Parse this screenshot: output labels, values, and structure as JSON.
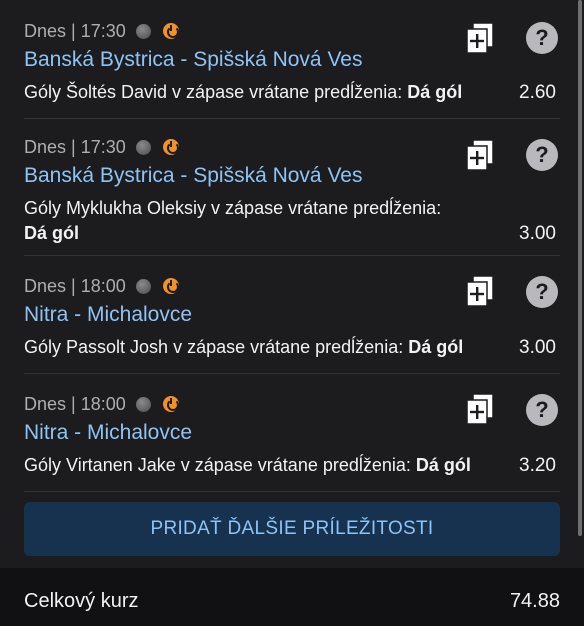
{
  "bets": [
    {
      "time": "Dnes | 17:30",
      "match": "Banská Bystrica - Spišská Nová Ves",
      "market": "Góly Šoltés David v zápase vrátane predĺženia:",
      "selection": "Dá gól",
      "odds": "2.60"
    },
    {
      "time": "Dnes | 17:30",
      "match": "Banská Bystrica - Spišská Nová Ves",
      "market": "Góly Myklukha Oleksiy v zápase vrátane predĺženia:",
      "selection": "Dá gól",
      "odds": "3.00"
    },
    {
      "time": "Dnes | 18:00",
      "match": "Nitra - Michalovce",
      "market": "Góly Passolt Josh v zápase vrátane predĺženia:",
      "selection": "Dá gól",
      "odds": "3.00"
    },
    {
      "time": "Dnes | 18:00",
      "match": "Nitra - Michalovce",
      "market": "Góly Virtanen Jake v zápase vrátane predĺženia:",
      "selection": "Dá gól",
      "odds": "3.20"
    }
  ],
  "add_button_label": "PRIDAŤ ĎALŠIE PRÍLEŽITOSTI",
  "footer": {
    "total_label": "Celkový kurz",
    "total_value": "74.88"
  },
  "icons": {
    "copy": "copy-add-icon",
    "help": "help-icon",
    "status": "status-dot-icon",
    "live": "live-stream-icon"
  },
  "colors": {
    "background": "#1c1c1e",
    "match_link": "#8ec3f5",
    "button_bg": "#16324f",
    "live_icon": "#f0912c"
  }
}
